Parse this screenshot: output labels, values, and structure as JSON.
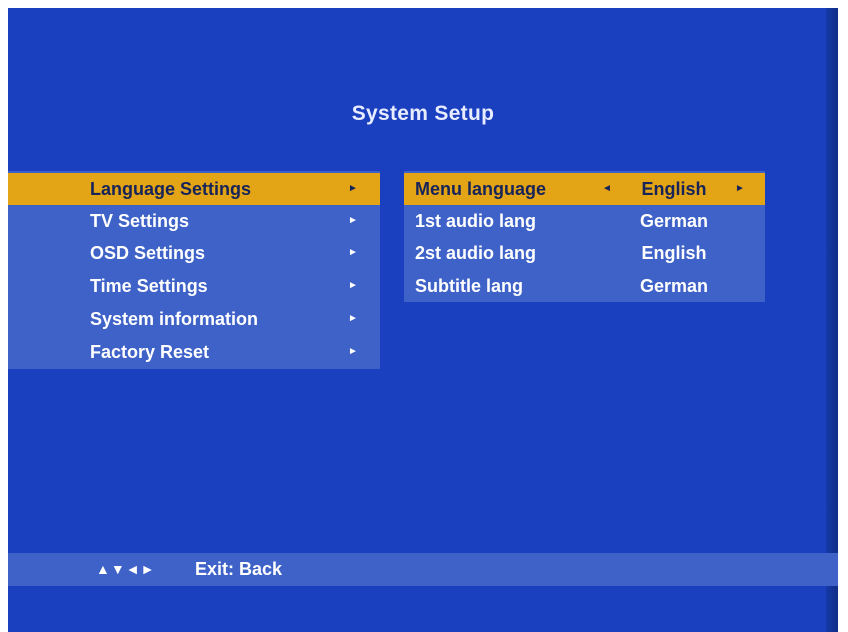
{
  "title": "System Setup",
  "menu": {
    "items": [
      {
        "label": "Language Settings",
        "arrow": "►",
        "selected": true
      },
      {
        "label": "TV Settings",
        "arrow": "►"
      },
      {
        "label": "OSD Settings",
        "arrow": "►"
      },
      {
        "label": "Time Settings",
        "arrow": "►"
      },
      {
        "label": "System information",
        "arrow": "►"
      },
      {
        "label": "Factory Reset",
        "arrow": "►"
      }
    ]
  },
  "language_panel": {
    "rows": [
      {
        "name": "Menu language",
        "value": "English",
        "left_arrow": "◄",
        "right_arrow": "►",
        "selected": true
      },
      {
        "name": "1st audio lang",
        "value": "German"
      },
      {
        "name": "2st audio lang",
        "value": "English"
      },
      {
        "name": "Subtitle lang",
        "value": "German"
      }
    ]
  },
  "help": {
    "icons": "▲▼◄►",
    "text": "Exit: Back"
  },
  "colors": {
    "background": "#1a3fbf",
    "panel": "#3e62c8",
    "highlight": "#e3a416"
  }
}
